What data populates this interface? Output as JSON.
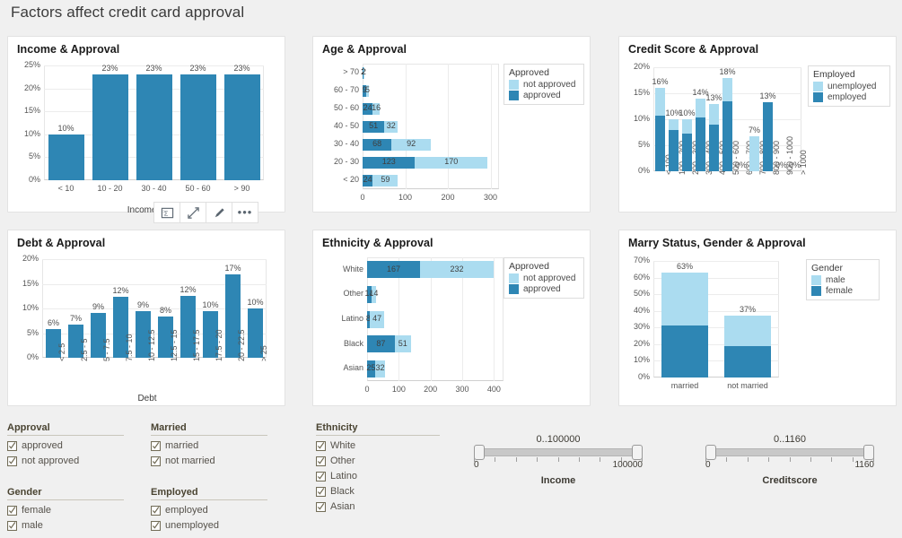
{
  "dashboard": {
    "title": "Factors affect credit card approval"
  },
  "card_toolbar": {
    "buttons": [
      {
        "name": "summary-icon",
        "label": ""
      },
      {
        "name": "expand-icon",
        "label": ""
      },
      {
        "name": "edit-pencil-icon",
        "label": ""
      },
      {
        "name": "more-options-icon",
        "label": "•••"
      }
    ]
  },
  "charts": {
    "income": {
      "title": "Income & Approval",
      "chart_data": {
        "type": "bar",
        "title": "Income & Approval",
        "xlabel": "Income(k)",
        "ylabel": "",
        "categories": [
          "< 10",
          "10 - 20",
          "30 - 40",
          "50 - 60",
          "> 90"
        ],
        "values": [
          10,
          23,
          23,
          23,
          23
        ],
        "data_labels": [
          "10%",
          "23%",
          "23%",
          "23%",
          "23%"
        ],
        "yticks": [
          "0%",
          "5%",
          "10%",
          "15%",
          "20%",
          "25%"
        ],
        "ylim": [
          0,
          25
        ],
        "grid": true,
        "legend": "none",
        "color": "#2e86b4"
      }
    },
    "age": {
      "title": "Age & Approval",
      "chart_data": {
        "type": "bar",
        "orientation": "horizontal",
        "stacked": true,
        "title": "Age & Approval",
        "xlabel": "",
        "ylabel": "",
        "categories": [
          "> 70",
          "60 - 70",
          "50 - 60",
          "40 - 50",
          "30 - 40",
          "20 - 30",
          "< 20"
        ],
        "series": [
          {
            "name": "approved",
            "color": "#2e86b4",
            "values": [
              2,
              9,
              24,
              51,
              68,
              123,
              24
            ]
          },
          {
            "name": "not approved",
            "color": "#abdcf0",
            "values": [
              2,
              5,
              16,
              32,
              92,
              170,
              59
            ]
          }
        ],
        "xticks": [
          "0",
          "100",
          "200",
          "300"
        ],
        "xlim": [
          0,
          320
        ],
        "grid": true,
        "legend": {
          "title": "Approved",
          "position": "right",
          "entries": [
            "not approved",
            "approved"
          ]
        }
      }
    },
    "credit_score": {
      "title": "Credit Score & Approval",
      "chart_data": {
        "type": "bar",
        "stacked": true,
        "title": "Credit Score & Approval",
        "xlabel": "",
        "ylabel": "",
        "categories": [
          "< 100",
          "100 - 200",
          "200 - 300",
          "300 - 400",
          "400 - 500",
          "500 - 600",
          "600 - 700",
          "700 - 800",
          "800 - 900",
          "900 - 1000",
          "> 1000"
        ],
        "series": [
          {
            "name": "employed",
            "color": "#2e86b4",
            "values": [
              10.7,
              7.9,
              7.3,
              10.4,
              8.9,
              13.4,
              0,
              0,
              13.3,
              0,
              0
            ]
          },
          {
            "name": "unemployed",
            "color": "#abdcf0",
            "values": [
              5.3,
              2.1,
              2.7,
              3.6,
              4.1,
              4.6,
              0,
              6.7,
              0,
              0,
              0
            ]
          }
        ],
        "data_labels": [
          "16%",
          "10%",
          "10%",
          "14%",
          "13%",
          "18%",
          "0%",
          "7%",
          "13%",
          "0%",
          "0%"
        ],
        "yticks": [
          "0%",
          "5%",
          "10%",
          "15%",
          "20%"
        ],
        "ylim": [
          0,
          20
        ],
        "grid": true,
        "legend": {
          "title": "Employed",
          "position": "right",
          "entries": [
            "unemployed",
            "employed"
          ]
        }
      }
    },
    "debt": {
      "title": "Debt & Approval",
      "chart_data": {
        "type": "bar",
        "title": "Debt & Approval",
        "xlabel": "Debt",
        "ylabel": "",
        "categories": [
          "< 2.5",
          "2.5 - 5",
          "5 - 7.5",
          "7.5 - 10",
          "10 - 12.5",
          "12.5 - 15",
          "15 - 17.5",
          "17.5 - 20",
          "20 - 22.5",
          "> 25"
        ],
        "values": [
          5.8,
          6.7,
          9.1,
          12.4,
          9.4,
          8.4,
          12.5,
          9.5,
          17.0,
          10.0
        ],
        "data_labels": [
          "6%",
          "7%",
          "9%",
          "12%",
          "9%",
          "8%",
          "12%",
          "10%",
          "17%",
          "10%"
        ],
        "yticks": [
          "0%",
          "5%",
          "10%",
          "15%",
          "20%"
        ],
        "ylim": [
          0,
          20
        ],
        "grid": true,
        "legend": "none",
        "color": "#2e86b4"
      }
    },
    "ethnicity": {
      "title": "Ethnicity & Approval",
      "chart_data": {
        "type": "bar",
        "orientation": "horizontal",
        "stacked": true,
        "title": "Ethnicity & Approval",
        "xlabel": "",
        "ylabel": "",
        "categories": [
          "White",
          "Other",
          "Latino",
          "Black",
          "Asian"
        ],
        "series": [
          {
            "name": "approved",
            "color": "#2e86b4",
            "values": [
              167,
              14,
              8,
              87,
              25
            ]
          },
          {
            "name": "not approved",
            "color": "#abdcf0",
            "values": [
              232,
              14,
              47,
              51,
              32
            ]
          }
        ],
        "xticks": [
          "0",
          "100",
          "200",
          "300",
          "400"
        ],
        "xlim": [
          0,
          430
        ],
        "grid": true,
        "legend": {
          "title": "Approved",
          "position": "right",
          "entries": [
            "not approved",
            "approved"
          ]
        }
      }
    },
    "marry": {
      "title": "Marry Status, Gender & Approval",
      "chart_data": {
        "type": "bar",
        "stacked": true,
        "title": "Marry Status, Gender & Approval",
        "xlabel": "",
        "ylabel": "",
        "categories": [
          "married",
          "not married"
        ],
        "series": [
          {
            "name": "female",
            "color": "#2e86b4",
            "values": [
              31.5,
              19.0
            ]
          },
          {
            "name": "male",
            "color": "#abdcf0",
            "values": [
              31.5,
              18.0
            ]
          }
        ],
        "data_labels": [
          "63%",
          "37%"
        ],
        "yticks": [
          "0%",
          "10%",
          "20%",
          "30%",
          "40%",
          "50%",
          "60%",
          "70%"
        ],
        "ylim": [
          0,
          70
        ],
        "grid": true,
        "legend": {
          "title": "Gender",
          "position": "right",
          "entries": [
            "male",
            "female"
          ]
        }
      }
    }
  },
  "filters": [
    {
      "name": "approval",
      "title": "Approval",
      "items": [
        {
          "label": "approved",
          "checked": true
        },
        {
          "label": "not approved",
          "checked": true
        }
      ]
    },
    {
      "name": "married",
      "title": "Married",
      "items": [
        {
          "label": "married",
          "checked": true
        },
        {
          "label": "not married",
          "checked": true
        }
      ]
    },
    {
      "name": "ethnicity",
      "title": "Ethnicity",
      "items": [
        {
          "label": "White",
          "checked": true
        },
        {
          "label": "Other",
          "checked": true
        },
        {
          "label": "Latino",
          "checked": true
        },
        {
          "label": "Black",
          "checked": true
        },
        {
          "label": "Asian",
          "checked": true
        }
      ]
    },
    {
      "name": "gender",
      "title": "Gender",
      "items": [
        {
          "label": "female",
          "checked": true
        },
        {
          "label": "male",
          "checked": true
        }
      ]
    },
    {
      "name": "employed",
      "title": "Employed",
      "items": [
        {
          "label": "employed",
          "checked": true
        },
        {
          "label": "unemployed",
          "checked": true
        }
      ]
    }
  ],
  "sliders": [
    {
      "name": "income",
      "label": "Income",
      "range_text": "0..100000",
      "min": "0",
      "max": "100000"
    },
    {
      "name": "creditscore",
      "label": "Creditscore",
      "range_text": "0..1160",
      "min": "0",
      "max": "1160"
    }
  ]
}
